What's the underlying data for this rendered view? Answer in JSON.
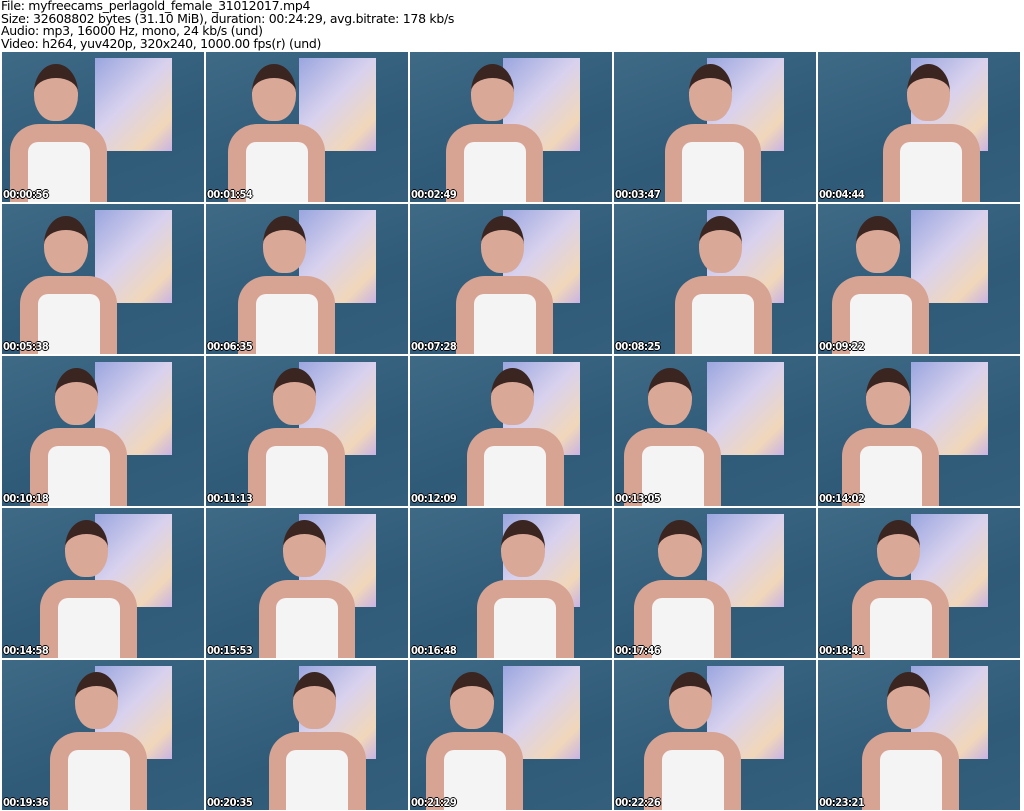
{
  "header": {
    "file": "File: myfreecams_perlagold_female_31012017.mp4",
    "size": "Size: 32608802 bytes (31.10 MiB), duration: 00:24:29, avg.bitrate: 178 kb/s",
    "audio": "Audio: mp3, 16000 Hz, mono, 24 kb/s (und)",
    "video": "Video: h264, yuv420p, 320x240, 1000.00 fps(r) (und)"
  },
  "thumbnails": [
    {
      "time": "00:00:56"
    },
    {
      "time": "00:01:54"
    },
    {
      "time": "00:02:49"
    },
    {
      "time": "00:03:47"
    },
    {
      "time": "00:04:44"
    },
    {
      "time": "00:05:38"
    },
    {
      "time": "00:06:35"
    },
    {
      "time": "00:07:28"
    },
    {
      "time": "00:08:25"
    },
    {
      "time": "00:09:22"
    },
    {
      "time": "00:10:18"
    },
    {
      "time": "00:11:13"
    },
    {
      "time": "00:12:09"
    },
    {
      "time": "00:13:05"
    },
    {
      "time": "00:14:02"
    },
    {
      "time": "00:14:58"
    },
    {
      "time": "00:15:53"
    },
    {
      "time": "00:16:48"
    },
    {
      "time": "00:17:46"
    },
    {
      "time": "00:18:41"
    },
    {
      "time": "00:19:36"
    },
    {
      "time": "00:20:35"
    },
    {
      "time": "00:21:29"
    },
    {
      "time": "00:22:26"
    },
    {
      "time": "00:23:21"
    }
  ]
}
